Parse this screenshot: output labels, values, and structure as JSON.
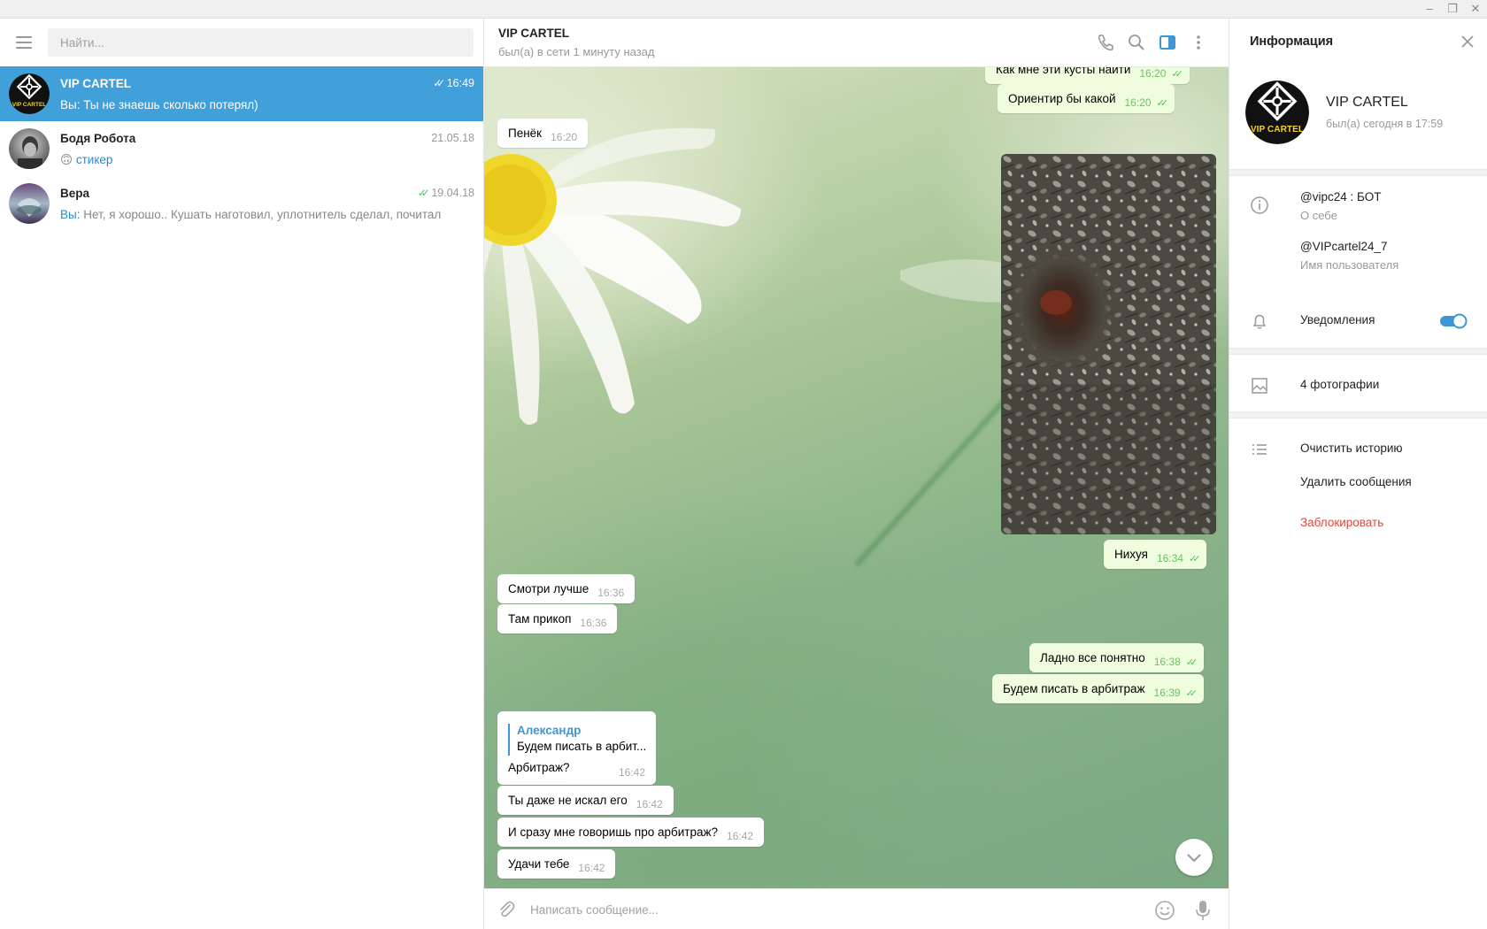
{
  "window": {
    "minimize": "‒",
    "restore": "❐",
    "close": "✕"
  },
  "search": {
    "placeholder": "Найти..."
  },
  "chats": [
    {
      "name": "VIP CARTEL",
      "time": "16:49",
      "sender": "Вы:",
      "message": "Ты не знаешь сколько потерял)",
      "read": true,
      "active": true,
      "avatar_text": "VIP CARTEL"
    },
    {
      "name": "Бодя Робота",
      "time": "21.05.18",
      "sender": "",
      "emoji": "🙃",
      "message": "стикер",
      "read": false,
      "active": false
    },
    {
      "name": "Вера",
      "time": "19.04.18",
      "sender": "Вы:",
      "message": "Нет, я хорошо.. Кушать наготовил, уплотнитель сделал, почитал",
      "read": true,
      "active": false
    }
  ],
  "header": {
    "title": "VIP CARTEL",
    "status": "был(а) в сети 1 минуту назад"
  },
  "messages": [
    {
      "id": "m0",
      "dir": "out",
      "text": "Как мне эти кусты найти",
      "time": "16:20",
      "partial": true
    },
    {
      "id": "m1",
      "dir": "out",
      "text": "Ориентир бы какой",
      "time": "16:20"
    },
    {
      "id": "m2",
      "dir": "in",
      "text": "Пенёк",
      "time": "16:20"
    },
    {
      "id": "m3",
      "dir": "out",
      "type": "photo"
    },
    {
      "id": "m4",
      "dir": "out",
      "text": "Нихуя",
      "time": "16:34"
    },
    {
      "id": "m5",
      "dir": "in",
      "text": "Смотри лучше",
      "time": "16:36"
    },
    {
      "id": "m6",
      "dir": "in",
      "text": "Там прикоп",
      "time": "16:36"
    },
    {
      "id": "m7",
      "dir": "out",
      "text": "Ладно все понятно",
      "time": "16:38"
    },
    {
      "id": "m8",
      "dir": "out",
      "text": "Будем писать в арбитраж",
      "time": "16:39"
    },
    {
      "id": "m9",
      "dir": "in",
      "reply_name": "Александр",
      "reply_text": "Будем писать в арбит...",
      "text": "Арбитраж?",
      "time": "16:42"
    },
    {
      "id": "m10",
      "dir": "in",
      "text": "Ты даже не искал его",
      "time": "16:42"
    },
    {
      "id": "m11",
      "dir": "in",
      "text": "И сразу мне говоришь про арбитраж?",
      "time": "16:42"
    },
    {
      "id": "m12",
      "dir": "in",
      "text": "Удачи тебе",
      "time": "16:42"
    }
  ],
  "composer": {
    "placeholder": "Написать сообщение..."
  },
  "info": {
    "title": "Информация",
    "name": "VIP CARTEL",
    "status": "был(а) сегодня в 17:59",
    "bio": "@vipc24 : БОТ",
    "bio_label": "О себе",
    "username": "@VIPcartel24_7",
    "username_label": "Имя пользователя",
    "notifications": "Уведомления",
    "notifications_on": true,
    "photos": "4 фотографии",
    "clear_history": "Очистить историю",
    "delete_messages": "Удалить сообщения",
    "block": "Заблокировать"
  },
  "colors": {
    "accent": "#419fd9",
    "outgoing": "#effdde",
    "read_check": "#4dc35e",
    "danger": "#e0483a"
  }
}
